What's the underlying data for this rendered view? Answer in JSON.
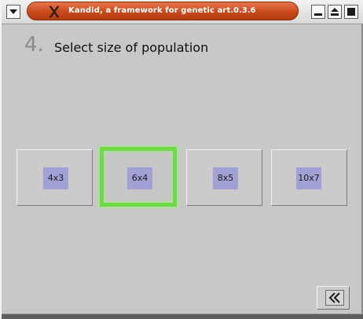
{
  "window": {
    "title": "Kandid, a framework for genetic art.",
    "version": "0.3.6",
    "icons": {
      "menu": "chevron-down-icon",
      "app": "x-logo-icon",
      "minimize": "minimize-icon",
      "maximize": "maximize-icon",
      "close": "close-icon"
    }
  },
  "step": {
    "number": "4.",
    "title": "Select size of population"
  },
  "population_options": [
    {
      "label": "4x3",
      "selected": false
    },
    {
      "label": "6x4",
      "selected": true
    },
    {
      "label": "8x5",
      "selected": false
    },
    {
      "label": "10x7",
      "selected": false
    }
  ],
  "navigation": {
    "back_icon": "rewind-icon"
  },
  "colors": {
    "title_bar_accent": "#c84a1c",
    "selection_highlight": "#6fd94a",
    "option_label_bg": "#a1a1d6",
    "window_bg": "#c8c8c8"
  }
}
